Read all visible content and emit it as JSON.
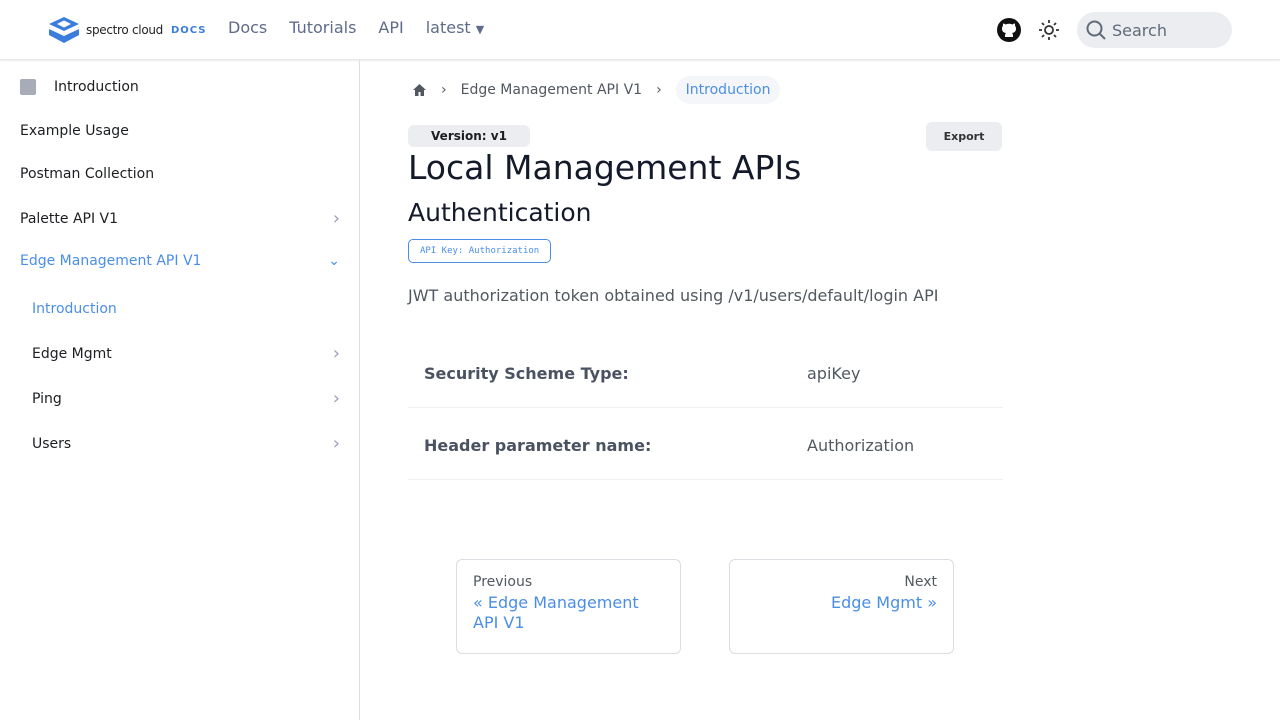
{
  "nav": {
    "brand": "spectro cloud",
    "docs": "DOCS",
    "links": [
      "Docs",
      "Tutorials",
      "API",
      "latest"
    ],
    "search_placeholder": "Search"
  },
  "sidebar": {
    "items": [
      {
        "label": "Introduction"
      },
      {
        "label": "Example Usage"
      },
      {
        "label": "Postman Collection"
      },
      {
        "label": "Palette API V1"
      },
      {
        "label": "Edge Management API V1"
      },
      {
        "label": "Introduction"
      },
      {
        "label": "Edge Mgmt"
      },
      {
        "label": "Ping"
      },
      {
        "label": "Users"
      }
    ]
  },
  "breadcrumb": [
    "Edge Management API V1",
    "Introduction"
  ],
  "main": {
    "version": "Version: v1",
    "export": "Export",
    "title": "Local Management APIs",
    "section": "Authentication",
    "badge": "API Key: Authorization",
    "description": "JWT authorization token obtained using /v1/users/default/login API",
    "rows": [
      {
        "k": "Security Scheme Type:",
        "v": "apiKey"
      },
      {
        "k": "Header parameter name:",
        "v": "Authorization"
      }
    ]
  },
  "pager": {
    "prev_label": "Previous",
    "prev_title": "« Edge Management API V1",
    "next_label": "Next",
    "next_title": "Edge Mgmt »"
  },
  "colors": {
    "accent": "#4a8ee8"
  }
}
